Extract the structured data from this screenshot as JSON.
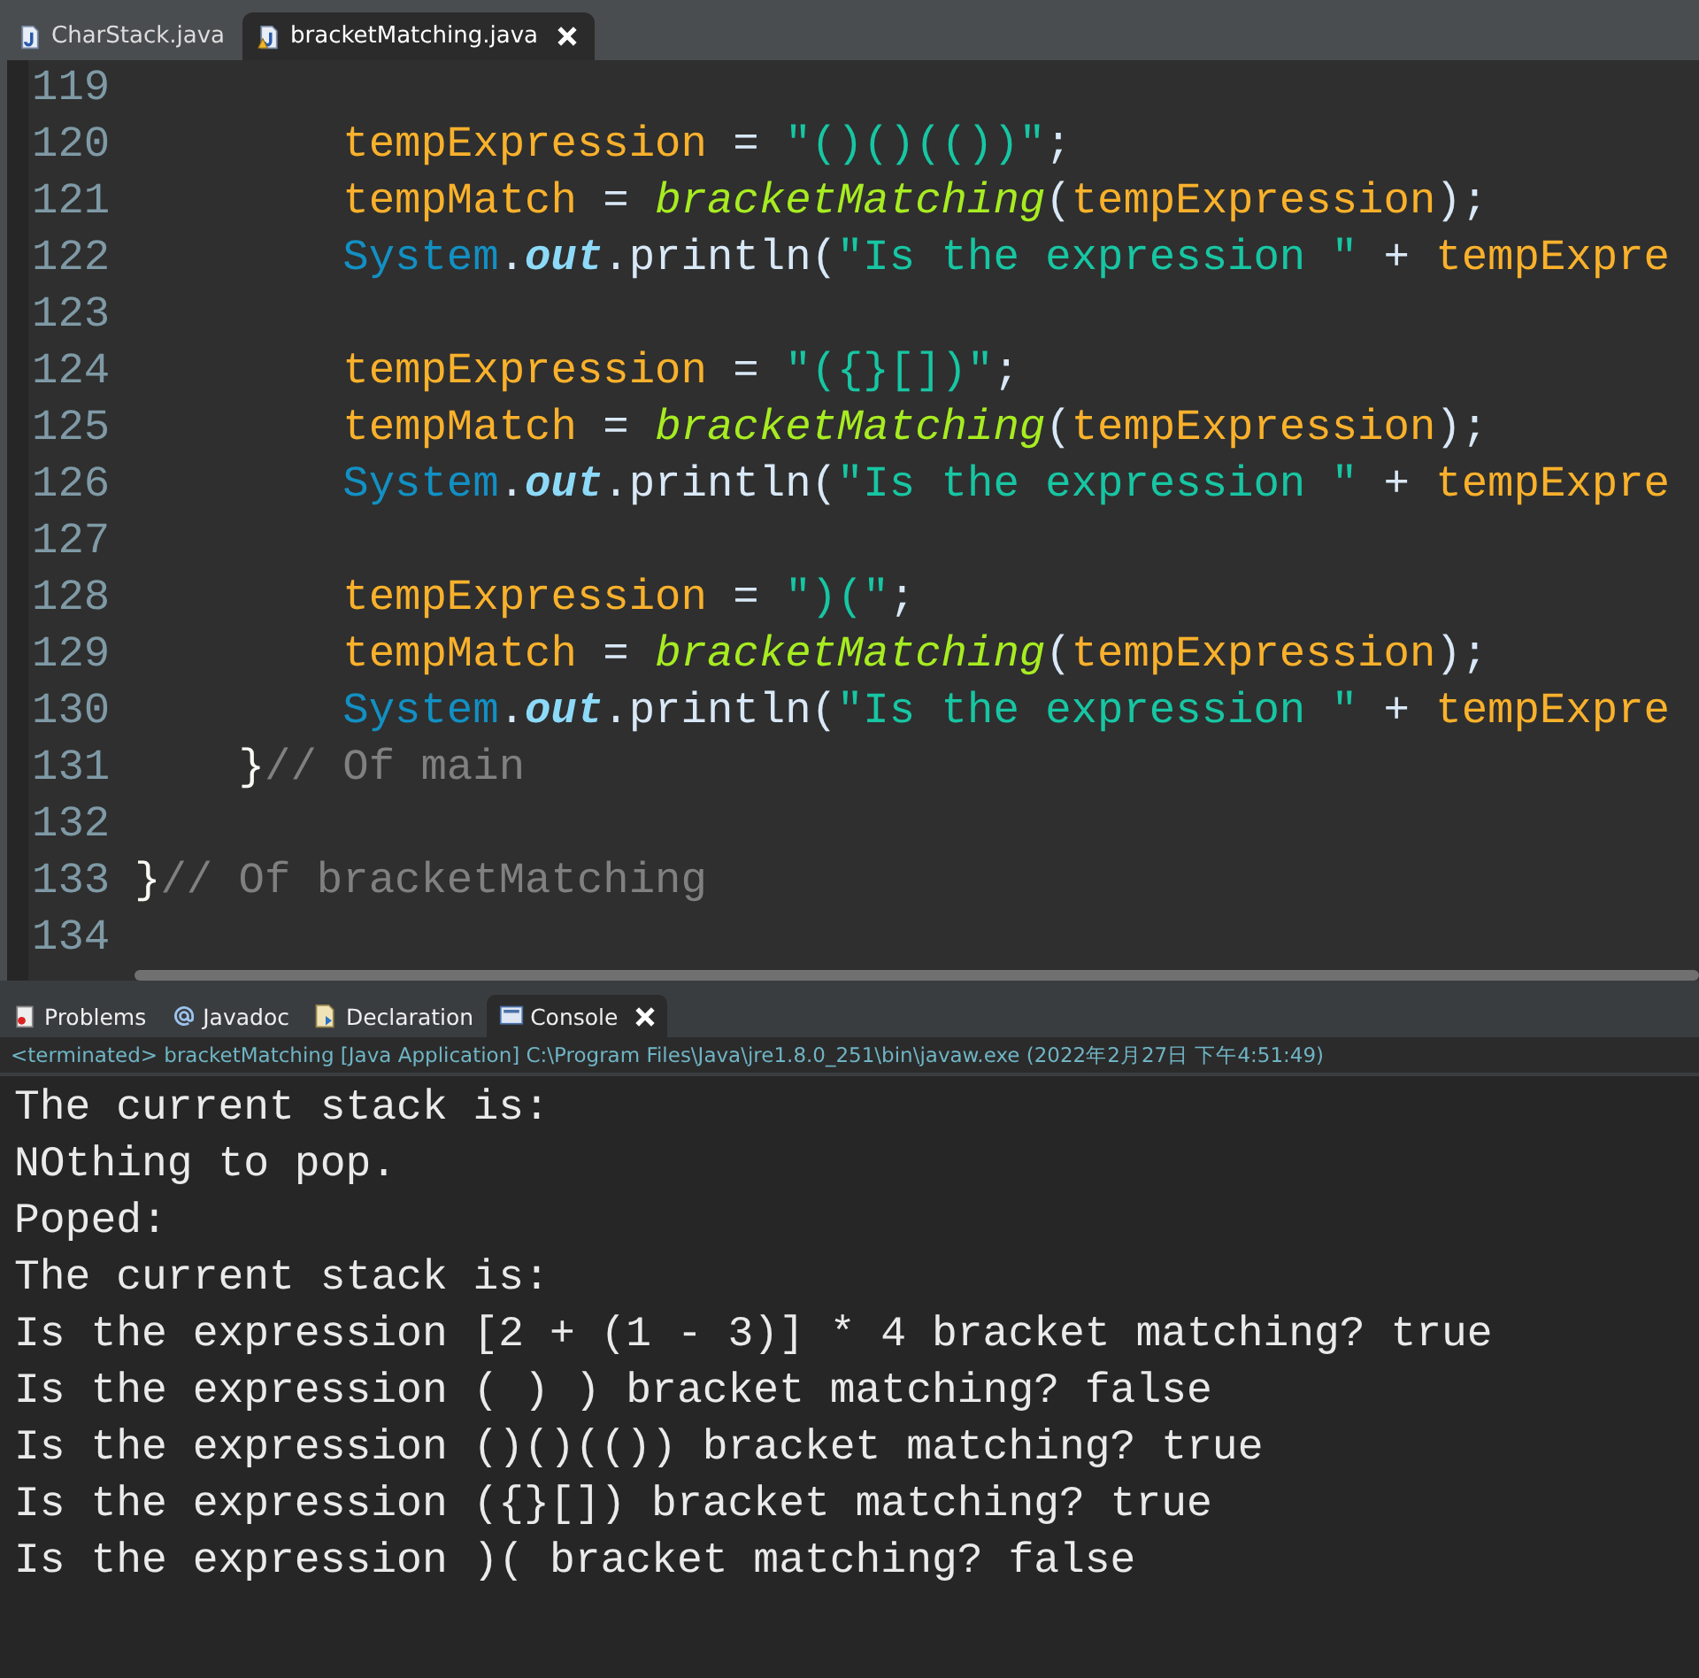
{
  "editor_tabs": [
    {
      "label": "CharStack.java",
      "selected": false,
      "warning": false
    },
    {
      "label": "bracketMatching.java",
      "selected": true,
      "warning": true
    }
  ],
  "code_lines": [
    {
      "number": "119"
    },
    {
      "number": "120",
      "tokens": [
        {
          "kind": "var",
          "text": "        tempExpression"
        },
        {
          "kind": "plain",
          "text": " = "
        },
        {
          "kind": "str",
          "text": "\"()()(())\""
        },
        {
          "kind": "plain",
          "text": ";"
        }
      ]
    },
    {
      "number": "121",
      "tokens": [
        {
          "kind": "var",
          "text": "        tempMatch"
        },
        {
          "kind": "plain",
          "text": " = "
        },
        {
          "kind": "fn",
          "text": "bracketMatching"
        },
        {
          "kind": "plain",
          "text": "("
        },
        {
          "kind": "var",
          "text": "tempExpression"
        },
        {
          "kind": "plain",
          "text": ");"
        }
      ]
    },
    {
      "number": "122",
      "tokens": [
        {
          "kind": "cls",
          "text": "        System"
        },
        {
          "kind": "plain",
          "text": "."
        },
        {
          "kind": "field",
          "text": "out"
        },
        {
          "kind": "plain",
          "text": ".println("
        },
        {
          "kind": "str",
          "text": "\"Is the expression \""
        },
        {
          "kind": "plain",
          "text": " + "
        },
        {
          "kind": "var",
          "text": "tempExpre"
        }
      ]
    },
    {
      "number": "123"
    },
    {
      "number": "124",
      "tokens": [
        {
          "kind": "var",
          "text": "        tempExpression"
        },
        {
          "kind": "plain",
          "text": " = "
        },
        {
          "kind": "str",
          "text": "\"({}[])\""
        },
        {
          "kind": "plain",
          "text": ";"
        }
      ]
    },
    {
      "number": "125",
      "tokens": [
        {
          "kind": "var",
          "text": "        tempMatch"
        },
        {
          "kind": "plain",
          "text": " = "
        },
        {
          "kind": "fn",
          "text": "bracketMatching"
        },
        {
          "kind": "plain",
          "text": "("
        },
        {
          "kind": "var",
          "text": "tempExpression"
        },
        {
          "kind": "plain",
          "text": ");"
        }
      ]
    },
    {
      "number": "126",
      "tokens": [
        {
          "kind": "cls",
          "text": "        System"
        },
        {
          "kind": "plain",
          "text": "."
        },
        {
          "kind": "field",
          "text": "out"
        },
        {
          "kind": "plain",
          "text": ".println("
        },
        {
          "kind": "str",
          "text": "\"Is the expression \""
        },
        {
          "kind": "plain",
          "text": " + "
        },
        {
          "kind": "var",
          "text": "tempExpre"
        }
      ]
    },
    {
      "number": "127"
    },
    {
      "number": "128",
      "tokens": [
        {
          "kind": "var",
          "text": "        tempExpression"
        },
        {
          "kind": "plain",
          "text": " = "
        },
        {
          "kind": "str",
          "text": "\")(\""
        },
        {
          "kind": "plain",
          "text": ";"
        }
      ]
    },
    {
      "number": "129",
      "tokens": [
        {
          "kind": "var",
          "text": "        tempMatch"
        },
        {
          "kind": "plain",
          "text": " = "
        },
        {
          "kind": "fn",
          "text": "bracketMatching"
        },
        {
          "kind": "plain",
          "text": "("
        },
        {
          "kind": "var",
          "text": "tempExpression"
        },
        {
          "kind": "plain",
          "text": ");"
        }
      ]
    },
    {
      "number": "130",
      "tokens": [
        {
          "kind": "cls",
          "text": "        System"
        },
        {
          "kind": "plain",
          "text": "."
        },
        {
          "kind": "field",
          "text": "out"
        },
        {
          "kind": "plain",
          "text": ".println("
        },
        {
          "kind": "str",
          "text": "\"Is the expression \""
        },
        {
          "kind": "plain",
          "text": " + "
        },
        {
          "kind": "var",
          "text": "tempExpre"
        }
      ]
    },
    {
      "number": "131",
      "tokens": [
        {
          "kind": "brace",
          "text": "    }"
        },
        {
          "kind": "comment",
          "text": "// Of main"
        }
      ]
    },
    {
      "number": "132"
    },
    {
      "number": "133",
      "tokens": [
        {
          "kind": "brace",
          "text": "}"
        },
        {
          "kind": "comment",
          "text": "// Of bracketMatching"
        }
      ]
    },
    {
      "number": "134"
    }
  ],
  "view_tabs": [
    {
      "label": "Problems",
      "selected": false
    },
    {
      "label": "Javadoc",
      "selected": false
    },
    {
      "label": "Declaration",
      "selected": false
    },
    {
      "label": "Console",
      "selected": true
    }
  ],
  "console": {
    "status": "<terminated> bracketMatching [Java Application] C:\\Program Files\\Java\\jre1.8.0_251\\bin\\javaw.exe (2022年2月27日 下午4:51:49)",
    "output": [
      "The current stack is:",
      "NOthing to pop.",
      "Poped:",
      "The current stack is:",
      "Is the expression [2 + (1 - 3)] * 4 bracket matching? true",
      "Is the expression ( ) ) bracket matching? false",
      "Is the expression ()()(()) bracket matching? true",
      "Is the expression ({}[]) bracket matching? true",
      "Is the expression )( bracket matching? false"
    ]
  }
}
